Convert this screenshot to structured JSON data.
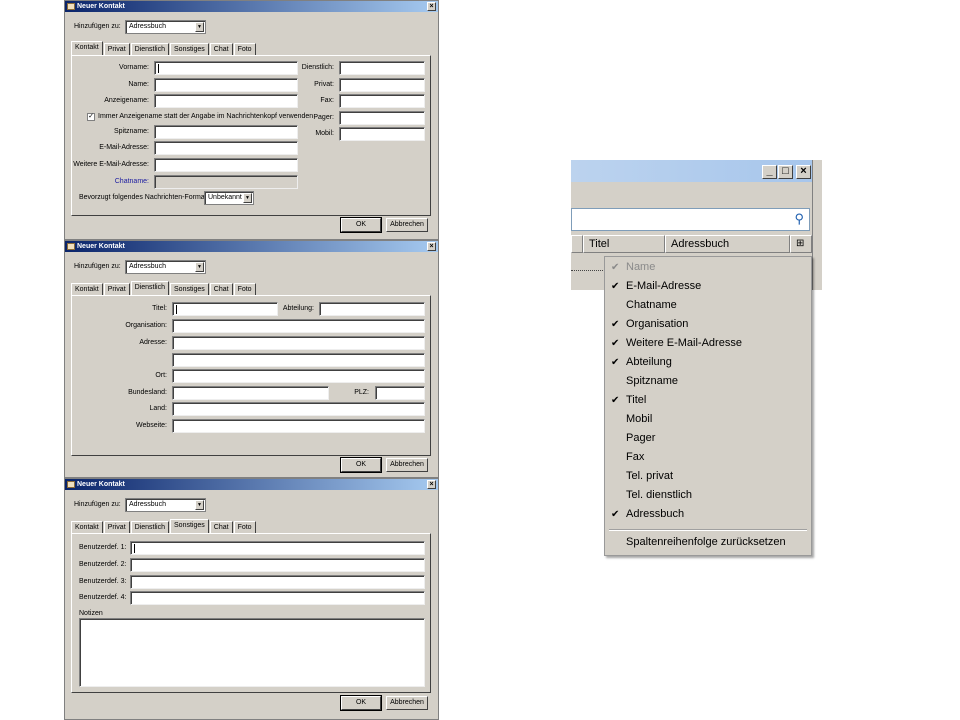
{
  "tabs": [
    "Kontakt",
    "Privat",
    "Dienstlich",
    "Sonstiges",
    "Chat",
    "Foto"
  ],
  "dialog_title": "Neuer Kontakt",
  "add_to_label": "Hinzufügen zu:",
  "add_to_value": "Adressbuch",
  "ok_label": "OK",
  "cancel_label": "Abbrechen",
  "contact": {
    "active_tab": 0,
    "left_labels": [
      "Vorname:",
      "Name:",
      "Anzeigename:"
    ],
    "always_display_name": "Immer Anzeigename statt der Angabe im Nachrichtenkopf verwenden",
    "always_display_checked": true,
    "lower_labels": [
      "Spitzname:",
      "E-Mail-Adresse:",
      "Weitere E-Mail-Adresse:"
    ],
    "chatname_label": "Chatname:",
    "format_label": "Bevorzugt folgendes Nachrichten-Format:",
    "format_value": "Unbekannt",
    "phone_labels": [
      "Dienstlich:",
      "Privat:",
      "Fax:",
      "Pager:",
      "Mobil:"
    ]
  },
  "business": {
    "active_tab": 2,
    "title_label": "Titel:",
    "department_label": "Abteilung:",
    "organisation_label": "Organisation:",
    "address_label": "Adresse:",
    "city_label": "Ort:",
    "state_label": "Bundesland:",
    "zip_label": "PLZ:",
    "country_label": "Land:",
    "website_label": "Webseite:"
  },
  "other": {
    "active_tab": 3,
    "custom_labels": [
      "Benutzerdef. 1:",
      "Benutzerdef. 2:",
      "Benutzerdef. 3:",
      "Benutzerdef. 4:"
    ],
    "notes_label": "Notizen"
  },
  "address_window": {
    "columns": [
      "Titel",
      "Adressbuch"
    ],
    "column_menu": {
      "items": [
        {
          "label": "Name",
          "checked": true,
          "disabled": true
        },
        {
          "label": "E-Mail-Adresse",
          "checked": true
        },
        {
          "label": "Chatname",
          "checked": false
        },
        {
          "label": "Organisation",
          "checked": true
        },
        {
          "label": "Weitere E-Mail-Adresse",
          "checked": true
        },
        {
          "label": "Abteilung",
          "checked": true
        },
        {
          "label": "Spitzname",
          "checked": false
        },
        {
          "label": "Titel",
          "checked": true
        },
        {
          "label": "Mobil",
          "checked": false
        },
        {
          "label": "Pager",
          "checked": false
        },
        {
          "label": "Fax",
          "checked": false
        },
        {
          "label": "Tel. privat",
          "checked": false
        },
        {
          "label": "Tel. dienstlich",
          "checked": false
        },
        {
          "label": "Adressbuch",
          "checked": true
        }
      ],
      "reset_label": "Spaltenreihenfolge zurücksetzen"
    }
  }
}
